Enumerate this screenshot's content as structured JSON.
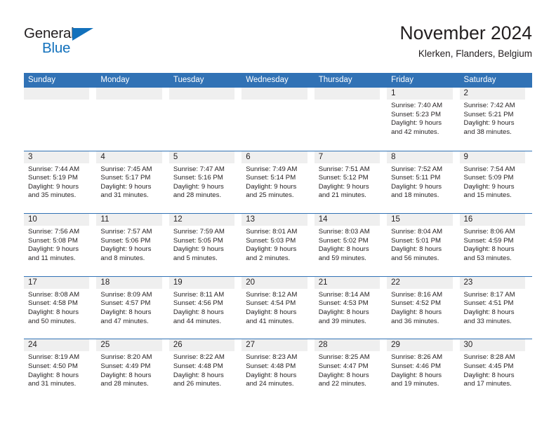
{
  "logo": {
    "word_one": "General",
    "word_two": "Blue",
    "triangle_icon": "triangle-icon",
    "brand_color": "#1271bc"
  },
  "header": {
    "title": "November 2024",
    "subtitle": "Klerken, Flanders, Belgium"
  },
  "theme": {
    "header_blue": "#3172b5",
    "daynum_band": "#efefef",
    "text": "#231f20"
  },
  "weekday_headers": [
    "Sunday",
    "Monday",
    "Tuesday",
    "Wednesday",
    "Thursday",
    "Friday",
    "Saturday"
  ],
  "weeks": [
    [
      {
        "day": "",
        "sunrise": "",
        "sunset": "",
        "daylight_line1": "",
        "daylight_line2": ""
      },
      {
        "day": "",
        "sunrise": "",
        "sunset": "",
        "daylight_line1": "",
        "daylight_line2": ""
      },
      {
        "day": "",
        "sunrise": "",
        "sunset": "",
        "daylight_line1": "",
        "daylight_line2": ""
      },
      {
        "day": "",
        "sunrise": "",
        "sunset": "",
        "daylight_line1": "",
        "daylight_line2": ""
      },
      {
        "day": "",
        "sunrise": "",
        "sunset": "",
        "daylight_line1": "",
        "daylight_line2": ""
      },
      {
        "day": "1",
        "sunrise": "Sunrise: 7:40 AM",
        "sunset": "Sunset: 5:23 PM",
        "daylight_line1": "Daylight: 9 hours",
        "daylight_line2": "and 42 minutes."
      },
      {
        "day": "2",
        "sunrise": "Sunrise: 7:42 AM",
        "sunset": "Sunset: 5:21 PM",
        "daylight_line1": "Daylight: 9 hours",
        "daylight_line2": "and 38 minutes."
      }
    ],
    [
      {
        "day": "3",
        "sunrise": "Sunrise: 7:44 AM",
        "sunset": "Sunset: 5:19 PM",
        "daylight_line1": "Daylight: 9 hours",
        "daylight_line2": "and 35 minutes."
      },
      {
        "day": "4",
        "sunrise": "Sunrise: 7:45 AM",
        "sunset": "Sunset: 5:17 PM",
        "daylight_line1": "Daylight: 9 hours",
        "daylight_line2": "and 31 minutes."
      },
      {
        "day": "5",
        "sunrise": "Sunrise: 7:47 AM",
        "sunset": "Sunset: 5:16 PM",
        "daylight_line1": "Daylight: 9 hours",
        "daylight_line2": "and 28 minutes."
      },
      {
        "day": "6",
        "sunrise": "Sunrise: 7:49 AM",
        "sunset": "Sunset: 5:14 PM",
        "daylight_line1": "Daylight: 9 hours",
        "daylight_line2": "and 25 minutes."
      },
      {
        "day": "7",
        "sunrise": "Sunrise: 7:51 AM",
        "sunset": "Sunset: 5:12 PM",
        "daylight_line1": "Daylight: 9 hours",
        "daylight_line2": "and 21 minutes."
      },
      {
        "day": "8",
        "sunrise": "Sunrise: 7:52 AM",
        "sunset": "Sunset: 5:11 PM",
        "daylight_line1": "Daylight: 9 hours",
        "daylight_line2": "and 18 minutes."
      },
      {
        "day": "9",
        "sunrise": "Sunrise: 7:54 AM",
        "sunset": "Sunset: 5:09 PM",
        "daylight_line1": "Daylight: 9 hours",
        "daylight_line2": "and 15 minutes."
      }
    ],
    [
      {
        "day": "10",
        "sunrise": "Sunrise: 7:56 AM",
        "sunset": "Sunset: 5:08 PM",
        "daylight_line1": "Daylight: 9 hours",
        "daylight_line2": "and 11 minutes."
      },
      {
        "day": "11",
        "sunrise": "Sunrise: 7:57 AM",
        "sunset": "Sunset: 5:06 PM",
        "daylight_line1": "Daylight: 9 hours",
        "daylight_line2": "and 8 minutes."
      },
      {
        "day": "12",
        "sunrise": "Sunrise: 7:59 AM",
        "sunset": "Sunset: 5:05 PM",
        "daylight_line1": "Daylight: 9 hours",
        "daylight_line2": "and 5 minutes."
      },
      {
        "day": "13",
        "sunrise": "Sunrise: 8:01 AM",
        "sunset": "Sunset: 5:03 PM",
        "daylight_line1": "Daylight: 9 hours",
        "daylight_line2": "and 2 minutes."
      },
      {
        "day": "14",
        "sunrise": "Sunrise: 8:03 AM",
        "sunset": "Sunset: 5:02 PM",
        "daylight_line1": "Daylight: 8 hours",
        "daylight_line2": "and 59 minutes."
      },
      {
        "day": "15",
        "sunrise": "Sunrise: 8:04 AM",
        "sunset": "Sunset: 5:01 PM",
        "daylight_line1": "Daylight: 8 hours",
        "daylight_line2": "and 56 minutes."
      },
      {
        "day": "16",
        "sunrise": "Sunrise: 8:06 AM",
        "sunset": "Sunset: 4:59 PM",
        "daylight_line1": "Daylight: 8 hours",
        "daylight_line2": "and 53 minutes."
      }
    ],
    [
      {
        "day": "17",
        "sunrise": "Sunrise: 8:08 AM",
        "sunset": "Sunset: 4:58 PM",
        "daylight_line1": "Daylight: 8 hours",
        "daylight_line2": "and 50 minutes."
      },
      {
        "day": "18",
        "sunrise": "Sunrise: 8:09 AM",
        "sunset": "Sunset: 4:57 PM",
        "daylight_line1": "Daylight: 8 hours",
        "daylight_line2": "and 47 minutes."
      },
      {
        "day": "19",
        "sunrise": "Sunrise: 8:11 AM",
        "sunset": "Sunset: 4:56 PM",
        "daylight_line1": "Daylight: 8 hours",
        "daylight_line2": "and 44 minutes."
      },
      {
        "day": "20",
        "sunrise": "Sunrise: 8:12 AM",
        "sunset": "Sunset: 4:54 PM",
        "daylight_line1": "Daylight: 8 hours",
        "daylight_line2": "and 41 minutes."
      },
      {
        "day": "21",
        "sunrise": "Sunrise: 8:14 AM",
        "sunset": "Sunset: 4:53 PM",
        "daylight_line1": "Daylight: 8 hours",
        "daylight_line2": "and 39 minutes."
      },
      {
        "day": "22",
        "sunrise": "Sunrise: 8:16 AM",
        "sunset": "Sunset: 4:52 PM",
        "daylight_line1": "Daylight: 8 hours",
        "daylight_line2": "and 36 minutes."
      },
      {
        "day": "23",
        "sunrise": "Sunrise: 8:17 AM",
        "sunset": "Sunset: 4:51 PM",
        "daylight_line1": "Daylight: 8 hours",
        "daylight_line2": "and 33 minutes."
      }
    ],
    [
      {
        "day": "24",
        "sunrise": "Sunrise: 8:19 AM",
        "sunset": "Sunset: 4:50 PM",
        "daylight_line1": "Daylight: 8 hours",
        "daylight_line2": "and 31 minutes."
      },
      {
        "day": "25",
        "sunrise": "Sunrise: 8:20 AM",
        "sunset": "Sunset: 4:49 PM",
        "daylight_line1": "Daylight: 8 hours",
        "daylight_line2": "and 28 minutes."
      },
      {
        "day": "26",
        "sunrise": "Sunrise: 8:22 AM",
        "sunset": "Sunset: 4:48 PM",
        "daylight_line1": "Daylight: 8 hours",
        "daylight_line2": "and 26 minutes."
      },
      {
        "day": "27",
        "sunrise": "Sunrise: 8:23 AM",
        "sunset": "Sunset: 4:48 PM",
        "daylight_line1": "Daylight: 8 hours",
        "daylight_line2": "and 24 minutes."
      },
      {
        "day": "28",
        "sunrise": "Sunrise: 8:25 AM",
        "sunset": "Sunset: 4:47 PM",
        "daylight_line1": "Daylight: 8 hours",
        "daylight_line2": "and 22 minutes."
      },
      {
        "day": "29",
        "sunrise": "Sunrise: 8:26 AM",
        "sunset": "Sunset: 4:46 PM",
        "daylight_line1": "Daylight: 8 hours",
        "daylight_line2": "and 19 minutes."
      },
      {
        "day": "30",
        "sunrise": "Sunrise: 8:28 AM",
        "sunset": "Sunset: 4:45 PM",
        "daylight_line1": "Daylight: 8 hours",
        "daylight_line2": "and 17 minutes."
      }
    ]
  ]
}
